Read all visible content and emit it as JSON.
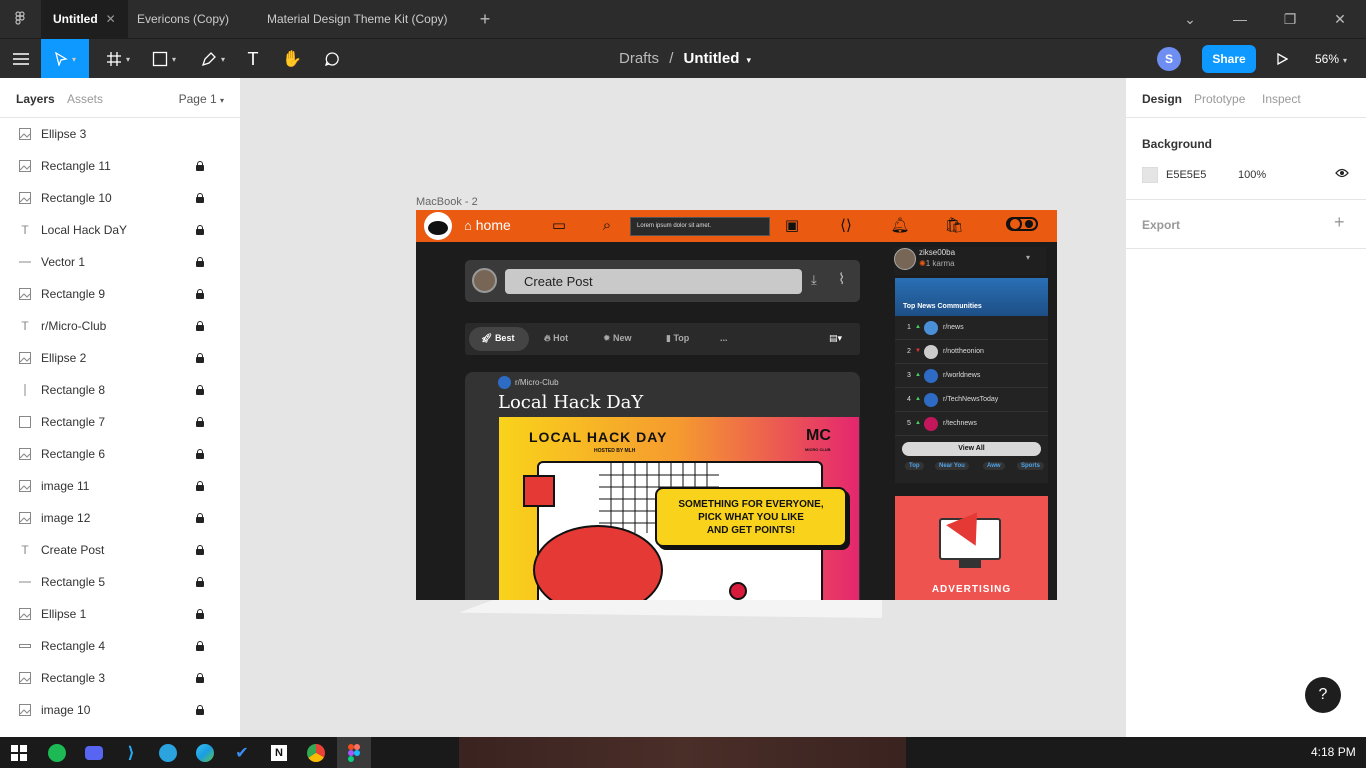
{
  "window": {
    "tabs": [
      {
        "label": "Untitled",
        "active": true
      },
      {
        "label": "Evericons (Copy)",
        "active": false
      },
      {
        "label": "Material Design Theme Kit (Copy)",
        "active": false
      }
    ]
  },
  "toolbar": {
    "breadcrumb_parent": "Drafts",
    "breadcrumb_sep": "/",
    "file_name": "Untitled",
    "avatar_initial": "S",
    "share_label": "Share",
    "zoom": "56%"
  },
  "left_panel": {
    "tab_layers": "Layers",
    "tab_assets": "Assets",
    "page_selector": "Page 1",
    "layers": [
      {
        "name": "Ellipse 3",
        "icon": "image-icon",
        "locked": false
      },
      {
        "name": "Rectangle 11",
        "icon": "image-icon",
        "locked": true
      },
      {
        "name": "Rectangle 10",
        "icon": "image-icon",
        "locked": true
      },
      {
        "name": "Local Hack DaY",
        "icon": "text-icon",
        "locked": true
      },
      {
        "name": "Vector 1",
        "icon": "line-icon",
        "locked": true
      },
      {
        "name": "Rectangle 9",
        "icon": "image-icon",
        "locked": true
      },
      {
        "name": "r/Micro-Club",
        "icon": "text-icon",
        "locked": true
      },
      {
        "name": "Ellipse 2",
        "icon": "image-icon",
        "locked": true
      },
      {
        "name": "Rectangle 8",
        "icon": "vline-icon",
        "locked": true
      },
      {
        "name": "Rectangle 7",
        "icon": "rect-icon",
        "locked": true
      },
      {
        "name": "Rectangle 6",
        "icon": "image-icon",
        "locked": true
      },
      {
        "name": "image 11",
        "icon": "image-icon",
        "locked": true
      },
      {
        "name": "image 12",
        "icon": "image-icon",
        "locked": true
      },
      {
        "name": "Create Post",
        "icon": "text-icon",
        "locked": true
      },
      {
        "name": "Rectangle 5",
        "icon": "line-icon",
        "locked": true
      },
      {
        "name": "Ellipse 1",
        "icon": "image-icon",
        "locked": true
      },
      {
        "name": "Rectangle 4",
        "icon": "thin-rect-icon",
        "locked": true
      },
      {
        "name": "Rectangle 3",
        "icon": "image-icon",
        "locked": true
      },
      {
        "name": "image 10",
        "icon": "image-icon",
        "locked": true
      }
    ]
  },
  "right_panel": {
    "tabs": [
      "Design",
      "Prototype",
      "Inspect"
    ],
    "background_title": "Background",
    "bg_hex": "E5E5E5",
    "bg_opacity": "100%",
    "export_title": "Export"
  },
  "canvas": {
    "frame_label": "MacBook - 2",
    "nav_home": "home",
    "search_text": "Lorem ipsum dolor sit amet.",
    "create_post": "Create Post",
    "sort": [
      "Best",
      "Hot",
      "New",
      "Top",
      "..."
    ],
    "post_sub": "r/Micro-Club",
    "post_title": "Local Hack DaY",
    "banner_title": "LOCAL HACK DAY",
    "banner_hosted": "HOSTED BY MLH",
    "banner_logo": "MC",
    "banner_logo_sub": "MICRO CLUB",
    "banner_msg": [
      "SOMETHING FOR EVERYONE,",
      "PICK WHAT YOU LIKE",
      "AND GET POINTS!"
    ],
    "user_name": "zikse00ba",
    "user_karma": "1 karma",
    "communities_title": "Top News Communities",
    "communities": [
      {
        "rank": "1",
        "name": "r/news",
        "trend": "up"
      },
      {
        "rank": "2",
        "name": "r/nottheonion",
        "trend": "down"
      },
      {
        "rank": "3",
        "name": "r/worldnews",
        "trend": "up"
      },
      {
        "rank": "4",
        "name": "r/TechNewsToday",
        "trend": "up"
      },
      {
        "rank": "5",
        "name": "r/technews",
        "trend": "up"
      }
    ],
    "view_all": "View All",
    "community_tags": [
      "Top",
      "Near You",
      "Aww",
      "Sports"
    ],
    "advert": "ADVERTISING"
  },
  "taskbar": {
    "clock": "4:18 PM"
  },
  "help_label": "?",
  "colors": {
    "accent": "#0d99ff",
    "reddit_orange": "#ea5a11",
    "canvas_bg": "#e5e5e5"
  }
}
